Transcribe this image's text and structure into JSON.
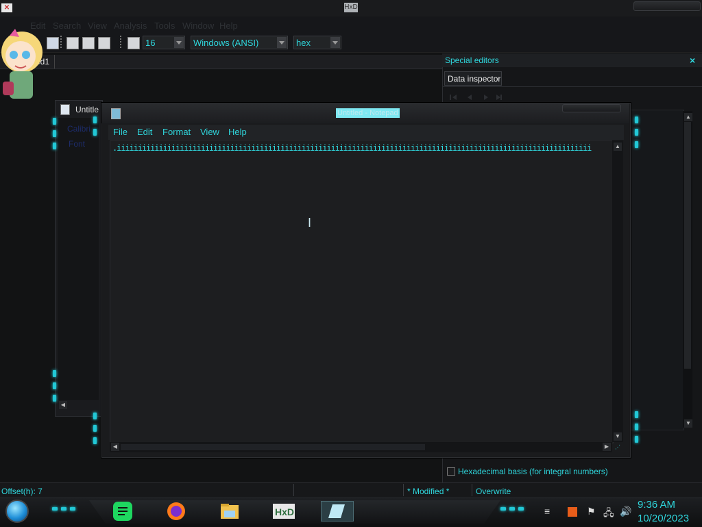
{
  "hxd": {
    "title_fragment": "HxD",
    "app_icon": "hxd-app-icon",
    "menu": [
      "Edit",
      "Search",
      "View",
      "Analysis",
      "Tools",
      "Window",
      "Help"
    ],
    "toolbar": {
      "bytes_per_row": "16",
      "charset": "Windows (ANSI)",
      "offset_base": "hex"
    },
    "doc_tab": "ed1",
    "special_editors": {
      "title": "Special editors",
      "close": "×",
      "tab": "Data inspector",
      "hex_basis_label": "Hexadecimal basis (for integral numbers)"
    },
    "status": {
      "offset": "Offset(h): 7",
      "modified": "* Modified *",
      "mode": "Overwrite"
    }
  },
  "background_window": {
    "title": "Untitle",
    "links": [
      "Calibri",
      "Font"
    ]
  },
  "notepad": {
    "title": "Untitled - Notepad",
    "menu": [
      "File",
      "Edit",
      "Format",
      "View",
      "Help"
    ],
    "content": ".iiiiiiiiiiiiiiiiiiiiiiiiiiiiiiiiiiiiiiiiiiiiiiiiiiiiiiiiiiiiiiiiiiiiiiiiiiiiiiiiiiiiiiiiiiiiiiiiiiiiiiiiiiiiiiiii"
  },
  "taskbar": {
    "apps": [
      "start-orb-icon",
      "spotify-icon",
      "firefox-icon",
      "file-explorer-icon",
      "hxd-icon",
      "notepad-icon"
    ],
    "clock_time": "9:36 AM",
    "clock_date": "10/20/2023"
  },
  "colors": {
    "accent": "#2fd6dc",
    "background": "#121314"
  }
}
